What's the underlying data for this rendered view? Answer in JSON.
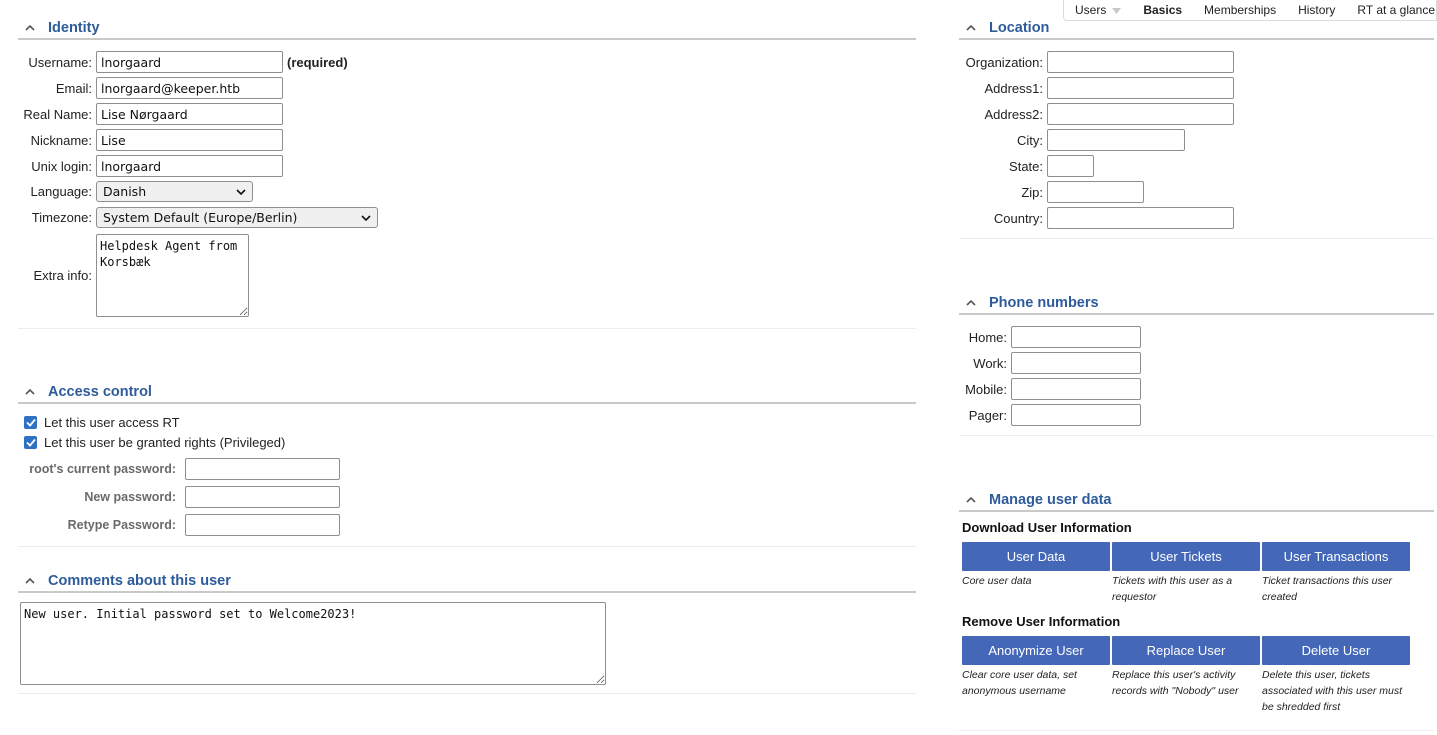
{
  "tabs": [
    {
      "label": "Users",
      "has_dropdown": true
    },
    {
      "label": "Basics",
      "active": true
    },
    {
      "label": "Memberships"
    },
    {
      "label": "History"
    },
    {
      "label": "RT at a glance"
    }
  ],
  "identity": {
    "title": "Identity",
    "username_label": "Username:",
    "username_value": "lnorgaard",
    "required_text": "(required)",
    "email_label": "Email:",
    "email_value": "lnorgaard@keeper.htb",
    "realname_label": "Real Name:",
    "realname_value": "Lise Nørgaard",
    "nickname_label": "Nickname:",
    "nickname_value": "Lise",
    "unix_label": "Unix login:",
    "unix_value": "lnorgaard",
    "language_label": "Language:",
    "language_value": "Danish",
    "timezone_label": "Timezone:",
    "timezone_value": "System Default (Europe/Berlin)",
    "extra_label": "Extra info:",
    "extra_value": "Helpdesk Agent from\nKorsbæk"
  },
  "access": {
    "title": "Access control",
    "check1_label": "Let this user access RT",
    "check2_label": "Let this user be granted rights (Privileged)",
    "current_pw_label": "root's current password:",
    "new_pw_label": "New password:",
    "retype_pw_label": "Retype Password:"
  },
  "comments": {
    "title": "Comments about this user",
    "value": "New user. Initial password set to Welcome2023!"
  },
  "location": {
    "title": "Location",
    "org_label": "Organization:",
    "addr1_label": "Address1:",
    "addr2_label": "Address2:",
    "city_label": "City:",
    "state_label": "State:",
    "zip_label": "Zip:",
    "country_label": "Country:"
  },
  "phones": {
    "title": "Phone numbers",
    "home_label": "Home:",
    "work_label": "Work:",
    "mobile_label": "Mobile:",
    "pager_label": "Pager:"
  },
  "manage": {
    "title": "Manage user data",
    "download_heading": "Download User Information",
    "user_data_btn": "User Data",
    "user_data_note": "Core user data",
    "user_tickets_btn": "User Tickets",
    "user_tickets_note": "Tickets with this user as a requestor",
    "user_tx_btn": "User Transactions",
    "user_tx_note": "Ticket transactions this user created",
    "remove_heading": "Remove User Information",
    "anonymize_btn": "Anonymize User",
    "anonymize_note": "Clear core user data, set anonymous username",
    "replace_btn": "Replace User",
    "replace_note": "Replace this user's activity records with \"Nobody\" user",
    "delete_btn": "Delete User",
    "delete_note": "Delete this user, tickets associated with this user must be shredded first"
  },
  "colors": {
    "section_title": "#2e5b9a",
    "button_bg": "#4467b8",
    "checkbox": "#2f72c4"
  }
}
